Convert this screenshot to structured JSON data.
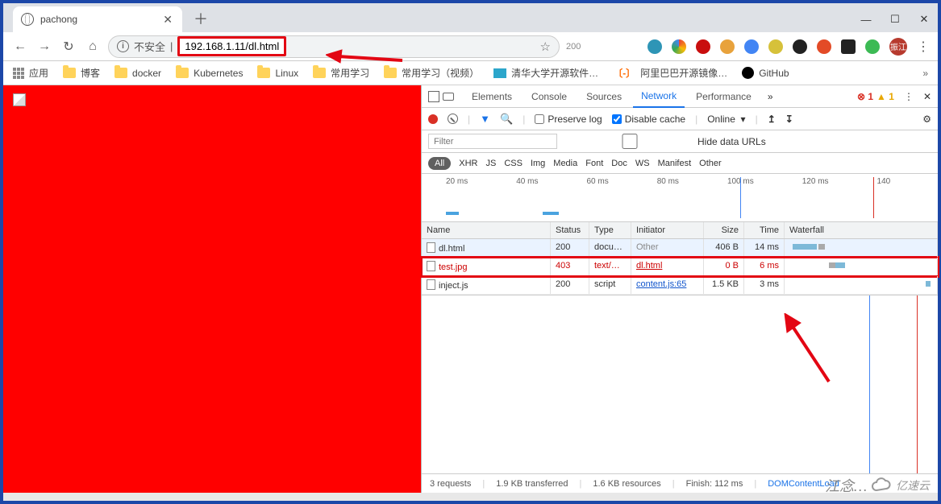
{
  "window": {
    "minimize": "—",
    "maximize": "☐",
    "close": "✕"
  },
  "tab": {
    "title": "pachong",
    "close": "✕",
    "new": "＋"
  },
  "nav": {
    "back": "←",
    "forward": "→",
    "reload": "↻",
    "home": "⌂"
  },
  "addr": {
    "insecure": "不安全",
    "url": "192.168.1.11/dl.html",
    "star": "☆",
    "two_hundred": "200"
  },
  "ext_colors": [
    "#2e95b6",
    "#f7b733",
    "#c90e0e",
    "#e8a23c",
    "#4285f4",
    "#d6c13a",
    "#222",
    "#e34b27",
    "#222",
    "#3cba54"
  ],
  "user_badge": "振江",
  "bookmarks": {
    "apps": "应用",
    "items": [
      "博客",
      "docker",
      "Kubernetes",
      "Linux",
      "常用学习",
      "常用学习（视频）"
    ],
    "tsinghua": "清华大学开源软件…",
    "aliyun": "阿里巴巴开源镜像…",
    "github": "GitHub"
  },
  "devtools": {
    "tabs": [
      "Elements",
      "Console",
      "Sources",
      "Network",
      "Performance"
    ],
    "active_tab": "Network",
    "more": "»",
    "errors": "1",
    "warnings": "1",
    "close": "✕",
    "menu": "⋮",
    "toolbar": {
      "preserve": "Preserve log",
      "disable_cache": "Disable cache",
      "online": "Online",
      "upload": "↥",
      "download": "↧",
      "gear": "⚙"
    },
    "filter_placeholder": "Filter",
    "hide_data_urls": "Hide data URLs",
    "types": [
      "All",
      "XHR",
      "JS",
      "CSS",
      "Img",
      "Media",
      "Font",
      "Doc",
      "WS",
      "Manifest",
      "Other"
    ],
    "timeline_labels": [
      "20 ms",
      "40 ms",
      "60 ms",
      "80 ms",
      "100 ms",
      "120 ms",
      "140"
    ],
    "columns": [
      "Name",
      "Status",
      "Type",
      "Initiator",
      "Size",
      "Time",
      "Waterfall"
    ],
    "rows": [
      {
        "name": "dl.html",
        "status": "200",
        "type": "docu…",
        "initiator": "Other",
        "initiator_link": false,
        "size": "406 B",
        "time": "14 ms",
        "highlight": true
      },
      {
        "name": "test.jpg",
        "status": "403",
        "type": "text/…",
        "initiator": "dl.html",
        "initiator_link": true,
        "size": "0 B",
        "time": "6 ms",
        "redbox": true
      },
      {
        "name": "inject.js",
        "status": "200",
        "type": "script",
        "initiator": "content.js:65",
        "initiator_link": true,
        "size": "1.5 KB",
        "time": "3 ms"
      }
    ],
    "status": {
      "requests": "3 requests",
      "transferred": "1.9 KB transferred",
      "resources": "1.6 KB resources",
      "finish": "Finish: 112 ms",
      "dom": "DOMContentLoad"
    }
  },
  "watermark": {
    "signature": "江念…",
    "brand": "亿速云"
  }
}
